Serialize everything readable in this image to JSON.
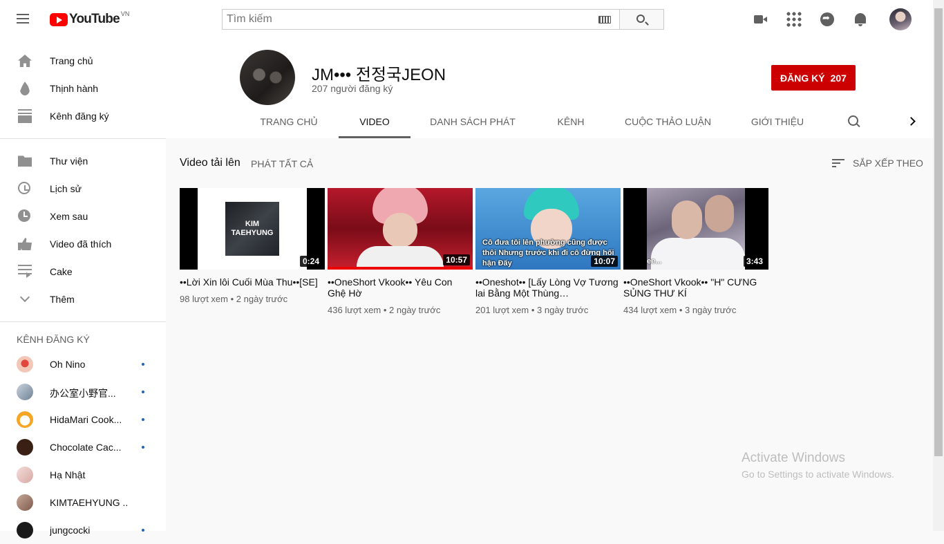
{
  "header": {
    "logo_text": "YouTube",
    "region": "VN",
    "search_placeholder": "Tìm kiếm"
  },
  "sidebar": {
    "main": [
      {
        "label": "Trang chủ",
        "icon": "home-icon"
      },
      {
        "label": "Thịnh hành",
        "icon": "fire-icon"
      },
      {
        "label": "Kênh đăng ký",
        "icon": "subscriptions-icon"
      }
    ],
    "library": [
      {
        "label": "Thư viện",
        "icon": "folder-icon"
      },
      {
        "label": "Lịch sử",
        "icon": "history-icon"
      },
      {
        "label": "Xem sau",
        "icon": "clock-icon"
      },
      {
        "label": "Video đã thích",
        "icon": "thumbs-up-icon"
      },
      {
        "label": "Cake",
        "icon": "playlist-icon"
      },
      {
        "label": "Thêm",
        "icon": "chevron-down-icon"
      }
    ],
    "subscriptions_title": "KÊNH ĐĂNG KÝ",
    "subscriptions": [
      {
        "label": "Oh Nino",
        "has_new": true,
        "avatar_color": "#f3c7b8"
      },
      {
        "label": "办公室小野官...",
        "has_new": true,
        "avatar_color": "#8d9fb2"
      },
      {
        "label": "HidaMari Cook...",
        "has_new": true,
        "avatar_color": "#f6a623"
      },
      {
        "label": "Chocolate Cac...",
        "has_new": true,
        "avatar_color": "#3a1f14"
      },
      {
        "label": "Hạ Nhật",
        "has_new": false,
        "avatar_color": "#e9c3c0"
      },
      {
        "label": "KIMTAEHYUNG ...",
        "has_new": false,
        "avatar_color": "#a88474"
      },
      {
        "label": "jungcocki",
        "has_new": true,
        "avatar_color": "#1a1a1a"
      }
    ]
  },
  "channel": {
    "name": "JM••• 전정국JEON",
    "subscribers": "207 người đăng ký",
    "subscribe_label": "ĐĂNG KÝ",
    "subscribe_count": "207",
    "accent": "#cc0000",
    "tabs": [
      "TRANG CHỦ",
      "VIDEO",
      "DANH SÁCH PHÁT",
      "KÊNH",
      "CUỘC THẢO LUẬN",
      "GIỚI THIỆU"
    ],
    "active_tab": "VIDEO"
  },
  "uploads": {
    "title": "Video tải lên",
    "play_all": "PHÁT TẤT CẢ",
    "sort_label": "SẮP XẾP THEO"
  },
  "videos": [
    {
      "title": "••Lời Xin lôi Cuối Mùa Thu••[SE]",
      "views": "98 lượt xem",
      "age": "2 ngày trước",
      "duration": "0:24",
      "thumb_text": "KIM TAEHYUNG"
    },
    {
      "title": "••OneShort Vkook•• Yêu Con Ghệ Hờ",
      "views": "436 lượt xem",
      "age": "2 ngày trước",
      "duration": "10:57",
      "watched": true
    },
    {
      "title": "••Oneshot•• [Lấy Lòng Vợ Tương lai Bằng Một Thùng…",
      "views": "201 lượt xem",
      "age": "3 ngày trước",
      "duration": "10:07",
      "thumb_caption": "Cô đưa tôi lên phường cũng được thôi Nhưng trước khi đi cô đừng hối hận Đấy"
    },
    {
      "title": "••OneShort Vkook•• \"H\" CƯNG SỦNG THƯ KÍ",
      "views": "434 lượt xem",
      "age": "3 ngày trước",
      "duration": "3:43",
      "thumb_text": "ee..."
    }
  ],
  "meta_separator": "•",
  "watermark": {
    "line1": "Activate Windows",
    "line2": "Go to Settings to activate Windows."
  }
}
